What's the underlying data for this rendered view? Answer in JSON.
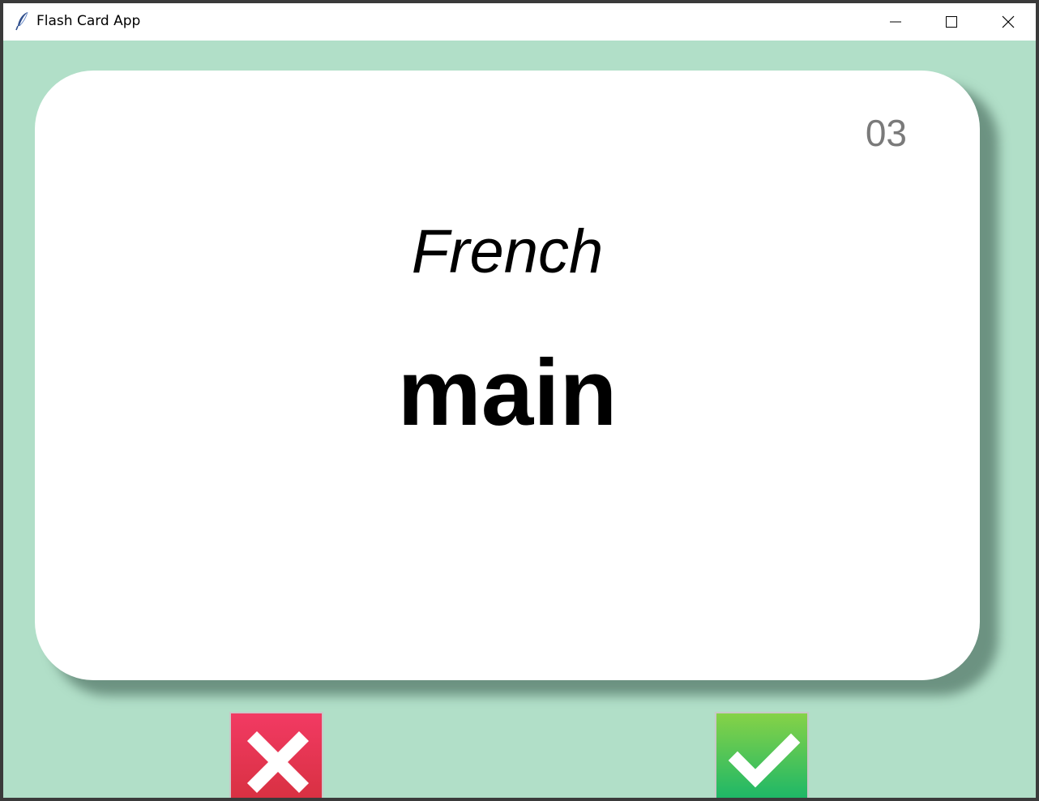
{
  "window": {
    "title": "Flash Card App",
    "icon": "feather-icon"
  },
  "controls": {
    "minimize_icon": "minimize-icon",
    "maximize_icon": "maximize-icon",
    "close_icon": "close-icon"
  },
  "card": {
    "number": "03",
    "language": "French",
    "word": "main"
  },
  "buttons": {
    "wrong_icon": "cross-icon",
    "right_icon": "checkmark-icon"
  },
  "colors": {
    "background": "#b1dfc8",
    "card": "#ffffff",
    "wrong": "#e8324f",
    "right": "#3cc35a"
  }
}
